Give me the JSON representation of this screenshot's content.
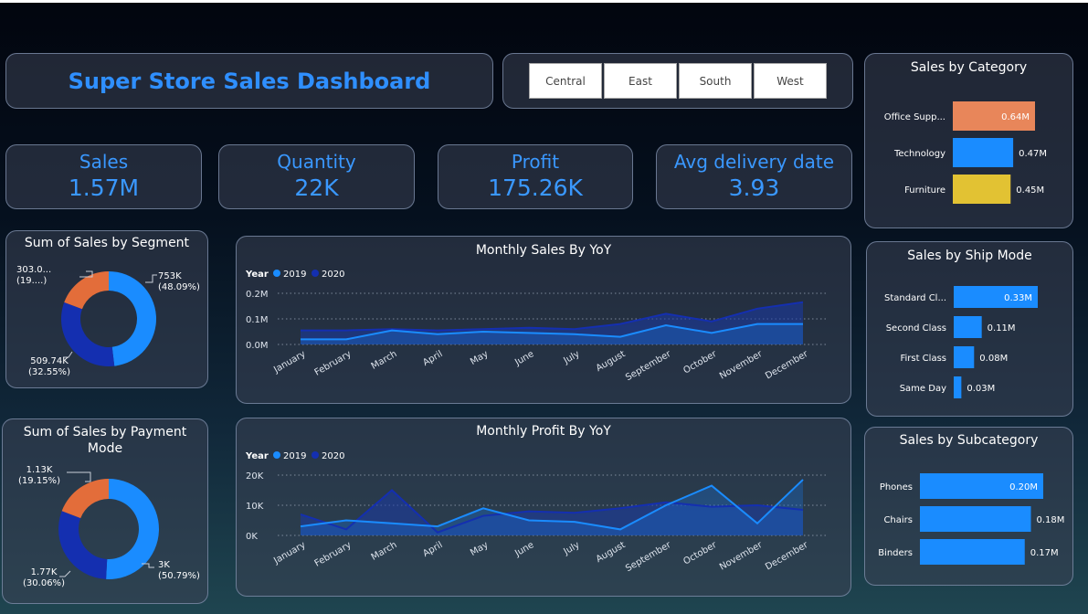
{
  "title": "Super Store Sales Dashboard",
  "filters": [
    "Central",
    "East",
    "South",
    "West"
  ],
  "kpis": {
    "sales": {
      "label": "Sales",
      "value": "1.57M"
    },
    "quantity": {
      "label": "Quantity",
      "value": "22K"
    },
    "profit": {
      "label": "Profit",
      "value": "175.26K"
    },
    "delivery": {
      "label": "Avg delivery date",
      "value": "3.93"
    }
  },
  "colors": {
    "accent": "#2f8fff",
    "series2019": "#1a8cff",
    "series2020": "#142fb0",
    "orange": "#e36d3a",
    "salmon": "#e8865a",
    "yellow": "#e2c233"
  },
  "chart_data": [
    {
      "id": "segment",
      "type": "pie",
      "title": "Sum of Sales by Segment",
      "labels": [
        "753K (48.09%)",
        "509.74K (32.55%)",
        "303.0... (19....)"
      ],
      "values": [
        753,
        509.74,
        303.0
      ],
      "colors": [
        "#1a8cff",
        "#142fb0",
        "#e36d3a"
      ]
    },
    {
      "id": "payment",
      "type": "pie",
      "title": "Sum of Sales by Payment Mode",
      "labels": [
        "3K (50.79%)",
        "1.77K (30.06%)",
        "1.13K (19.15%)"
      ],
      "values": [
        3,
        1.77,
        1.13
      ],
      "colors": [
        "#1a8cff",
        "#142fb0",
        "#e36d3a"
      ]
    },
    {
      "id": "monthlySales",
      "type": "line",
      "title": "Monthly Sales By YoY",
      "legend_title": "Year",
      "categories": [
        "January",
        "February",
        "March",
        "April",
        "May",
        "June",
        "July",
        "August",
        "September",
        "October",
        "November",
        "December"
      ],
      "series": [
        {
          "name": "2019",
          "values": [
            0.02,
            0.02,
            0.055,
            0.04,
            0.05,
            0.045,
            0.04,
            0.03,
            0.075,
            0.045,
            0.08,
            0.08
          ]
        },
        {
          "name": "2020",
          "values": [
            0.055,
            0.055,
            0.06,
            0.055,
            0.06,
            0.065,
            0.06,
            0.08,
            0.12,
            0.09,
            0.14,
            0.165
          ]
        }
      ],
      "yticks": [
        "0.0M",
        "0.1M",
        "0.2M"
      ],
      "ylim": [
        0,
        0.2
      ],
      "grid": true
    },
    {
      "id": "monthlyProfit",
      "type": "line",
      "title": "Monthly Profit By YoY",
      "legend_title": "Year",
      "categories": [
        "January",
        "February",
        "March",
        "April",
        "May",
        "June",
        "July",
        "August",
        "September",
        "October",
        "November",
        "December"
      ],
      "series": [
        {
          "name": "2019",
          "values": [
            3000,
            5000,
            4000,
            3000,
            9000,
            5000,
            4500,
            2000,
            10000,
            16500,
            4000,
            18500
          ]
        },
        {
          "name": "2020",
          "values": [
            7000,
            2000,
            15000,
            1000,
            6500,
            8000,
            7500,
            9000,
            11000,
            9500,
            10000,
            8500
          ]
        }
      ],
      "yticks": [
        "0K",
        "10K",
        "20K"
      ],
      "ylim": [
        0,
        20000
      ],
      "grid": true
    },
    {
      "id": "category",
      "type": "bar",
      "title": "Sales by Category",
      "categories": [
        "Office Supp...",
        "Technology",
        "Furniture"
      ],
      "values": [
        0.64,
        0.47,
        0.45
      ],
      "labels": [
        "0.64M",
        "0.47M",
        "0.45M"
      ],
      "colors": [
        "#e8865a",
        "#1a8cff",
        "#e2c233"
      ]
    },
    {
      "id": "shipMode",
      "type": "bar",
      "title": "Sales by Ship Mode",
      "categories": [
        "Standard Cl...",
        "Second Class",
        "First Class",
        "Same Day"
      ],
      "values": [
        0.33,
        0.11,
        0.08,
        0.03
      ],
      "labels": [
        "0.33M",
        "0.11M",
        "0.08M",
        "0.03M"
      ]
    },
    {
      "id": "subcategory",
      "type": "bar",
      "title": "Sales by Subcategory",
      "categories": [
        "Phones",
        "Chairs",
        "Binders"
      ],
      "values": [
        0.2,
        0.18,
        0.17
      ],
      "labels": [
        "0.20M",
        "0.18M",
        "0.17M"
      ]
    }
  ]
}
